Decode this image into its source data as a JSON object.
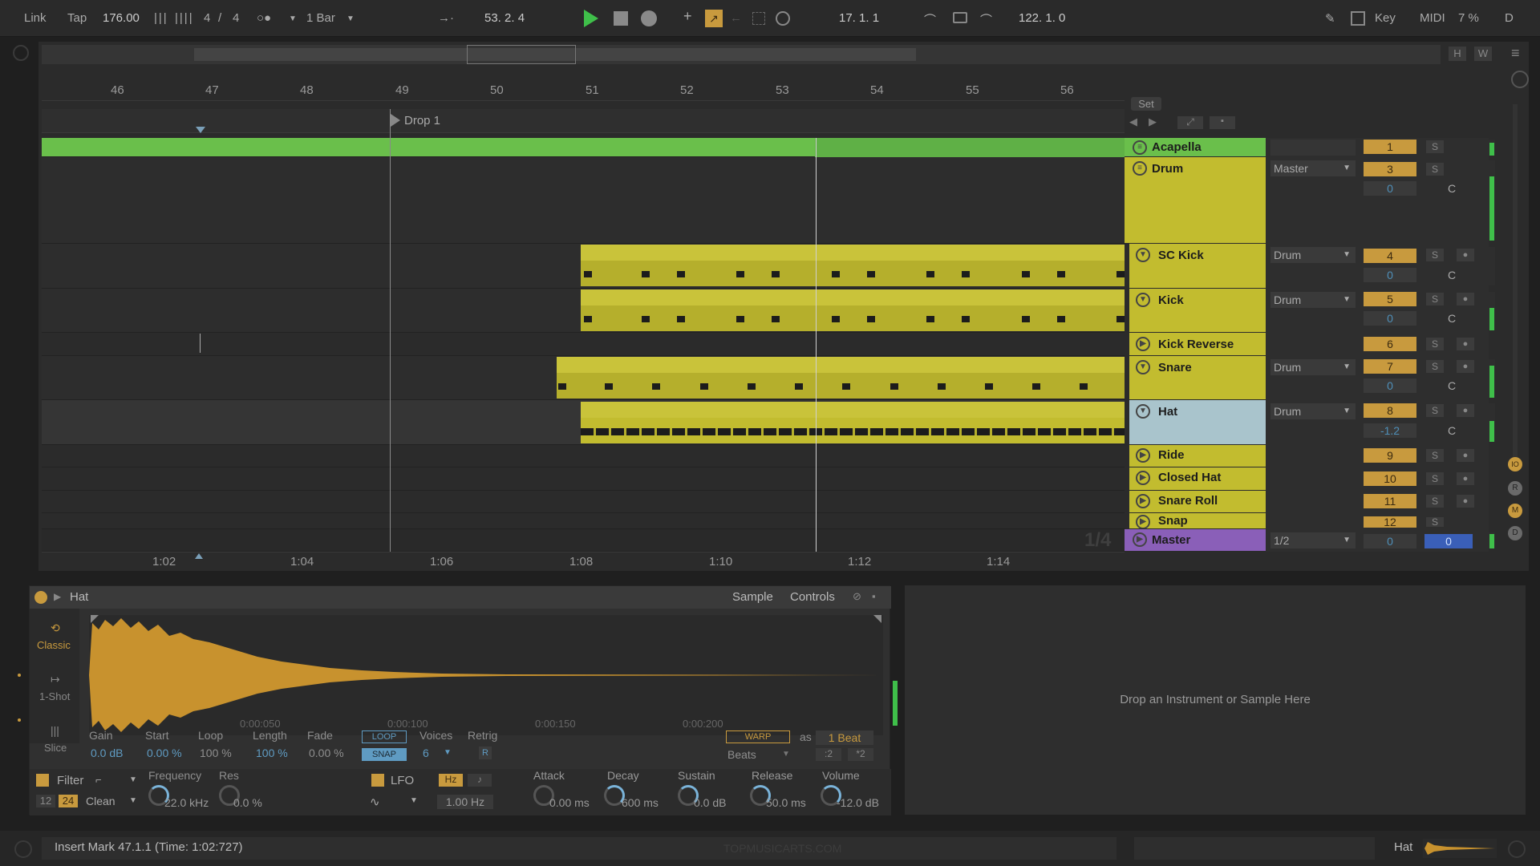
{
  "toolbar": {
    "link": "Link",
    "tap": "Tap",
    "tempo": "176.00",
    "signature_num": "4",
    "signature_sep": "/",
    "signature_den": "4",
    "quantize": "1 Bar",
    "position": "53.  2.  4",
    "loop_start": "17.  1.  1",
    "loop_length": "122.  1.  0",
    "key": "Key",
    "midi": "MIDI",
    "cpu": "7 %",
    "disk": "D"
  },
  "overview": {
    "h_label": "H",
    "w_label": "W"
  },
  "ruler": {
    "bars": [
      "46",
      "47",
      "48",
      "49",
      "50",
      "51",
      "52",
      "53",
      "54",
      "55",
      "56"
    ],
    "times": [
      "1:02",
      "1:04",
      "1:06",
      "1:08",
      "1:10",
      "1:12",
      "1:14"
    ]
  },
  "locator": {
    "name": "Drop 1"
  },
  "set_label": "Set",
  "page_indicator": "1/4",
  "tracks": [
    {
      "name": "Acapella",
      "icon": "group-fold-icon",
      "number": "1",
      "routing": "",
      "color": "#6abf4b"
    },
    {
      "name": "Drum",
      "icon": "group-fold-icon",
      "number": "3",
      "routing": "Master",
      "volume": "0",
      "pan": "C",
      "color": "#c2bc2f"
    },
    {
      "name": "SC Kick",
      "icon": "fold-icon",
      "number": "4",
      "routing": "Drum",
      "volume": "0",
      "pan": "C",
      "color": "#c2bc2f"
    },
    {
      "name": "Kick",
      "icon": "fold-icon",
      "number": "5",
      "routing": "Drum",
      "volume": "0",
      "pan": "C",
      "color": "#c2bc2f"
    },
    {
      "name": "Kick Reverse",
      "icon": "play-icon",
      "number": "6",
      "routing": "",
      "color": "#c2bc2f"
    },
    {
      "name": "Snare",
      "icon": "fold-icon",
      "number": "7",
      "routing": "Drum",
      "volume": "0",
      "pan": "C",
      "color": "#c2bc2f"
    },
    {
      "name": "Hat",
      "icon": "fold-icon",
      "number": "8",
      "routing": "Drum",
      "volume": "-1.2",
      "pan": "C",
      "color": "#a9c4cc"
    },
    {
      "name": "Ride",
      "icon": "play-icon",
      "number": "9",
      "routing": "",
      "color": "#c2bc2f"
    },
    {
      "name": "Closed Hat",
      "icon": "play-icon",
      "number": "10",
      "routing": "",
      "color": "#c2bc2f"
    },
    {
      "name": "Snare Roll",
      "icon": "play-icon",
      "number": "11",
      "routing": "",
      "color": "#c2bc2f"
    },
    {
      "name": "Snap",
      "icon": "play-icon",
      "number": "12",
      "routing": "",
      "color": "#c2bc2f"
    }
  ],
  "master": {
    "name": "Master",
    "routing": "1/2",
    "volume": "0",
    "pan": "0",
    "color": "#8a5fb8"
  },
  "simpler": {
    "title": "Hat",
    "tab_sample": "Sample",
    "tab_controls": "Controls",
    "modes": [
      "Classic",
      "1-Shot",
      "Slice"
    ],
    "waveform_times": [
      "0:00:050",
      "0:00:100",
      "0:00:150",
      "0:00:200"
    ],
    "params": [
      {
        "label": "Gain",
        "value": "0.0 dB"
      },
      {
        "label": "Start",
        "value": "0.00 %"
      },
      {
        "label": "Loop",
        "value": "100 %"
      },
      {
        "label": "Length",
        "value": "100 %"
      },
      {
        "label": "Fade",
        "value": "0.00 %"
      },
      {
        "label": "Voices",
        "value": "6"
      },
      {
        "label": "Retrig",
        "value": "R"
      }
    ],
    "loop_btn": "LOOP",
    "snap_btn": "SNAP",
    "warp_btn": "WARP",
    "warp_as": "as",
    "warp_beats": "1 Beat",
    "warp_mode": "Beats",
    "half": ":2",
    "double": "*2",
    "filter": {
      "label": "Filter",
      "freq_label": "Frequency",
      "res_label": "Res",
      "freq": "22.0 kHz",
      "res": "0.0 %",
      "slope12": "12",
      "slope24": "24",
      "circuit": "Clean"
    },
    "lfo": {
      "label": "LFO",
      "hz": "Hz",
      "rate": "1.00 Hz"
    },
    "env": [
      {
        "label": "Attack",
        "value": "0.00 ms"
      },
      {
        "label": "Decay",
        "value": "600 ms"
      },
      {
        "label": "Sustain",
        "value": "0.0 dB"
      },
      {
        "label": "Release",
        "value": "50.0 ms"
      },
      {
        "label": "Volume",
        "value": "-12.0 dB"
      }
    ]
  },
  "drop_zone": "Drop an Instrument or Sample Here",
  "status": {
    "text": "Insert Mark 47.1.1 (Time: 1:02:727)",
    "watermark": "TOPMUSICARTS.COM",
    "track_label": "Hat"
  }
}
